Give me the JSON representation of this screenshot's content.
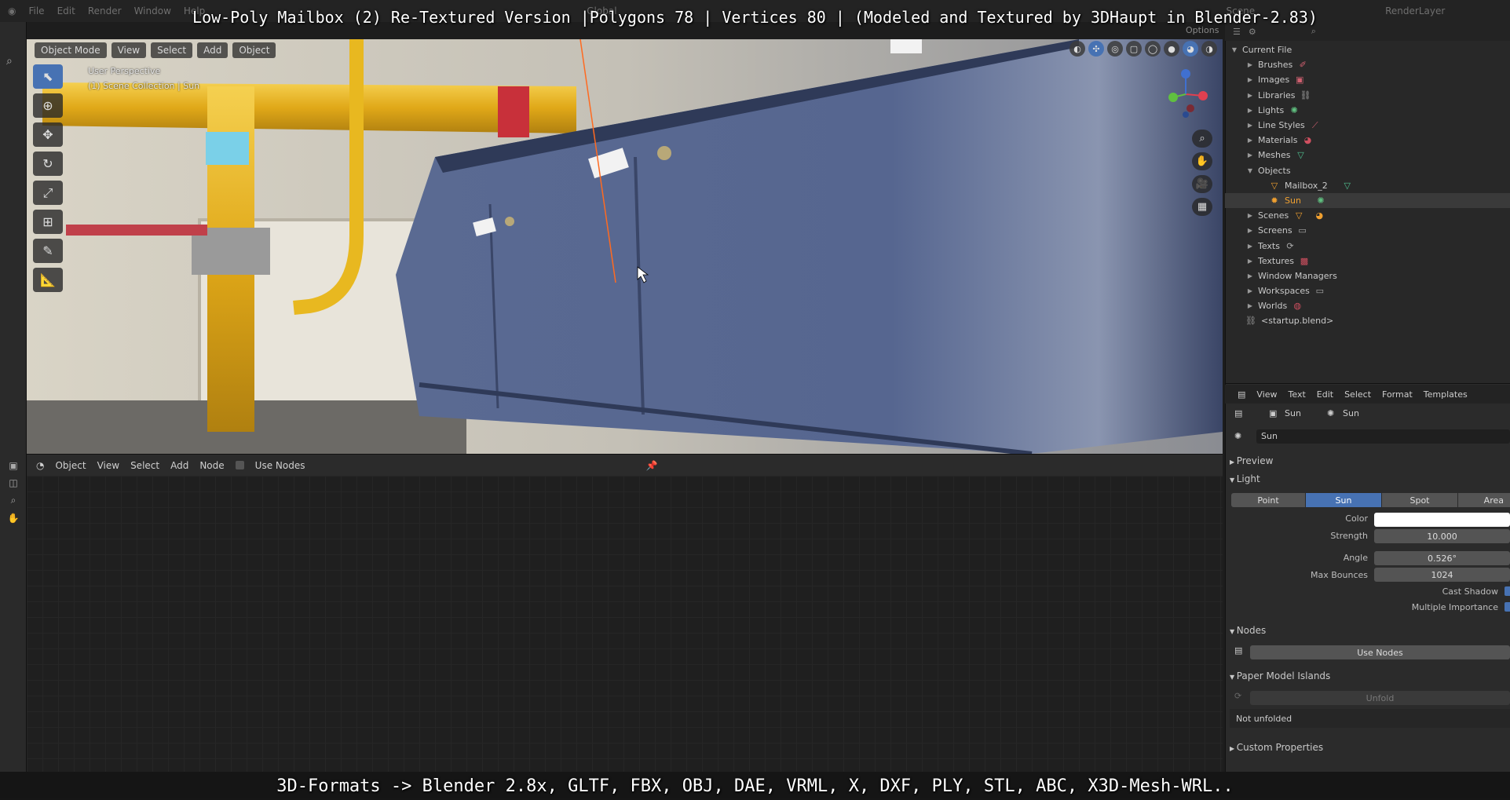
{
  "overlay": {
    "title": "Low-Poly Mailbox (2) Re-Textured Version |Polygons 78 | Vertices 80 | (Modeled and Textured by 3DHaupt in Blender-2.83)",
    "bottom": "3D-Formats -> Blender 2.8x, GLTF, FBX, OBJ, DAE, VRML, X, DXF, PLY, STL, ABC, X3D-Mesh-WRL.."
  },
  "topbar": {
    "menus": [
      "File",
      "Edit",
      "Render",
      "Window",
      "Help"
    ],
    "scene": "Scene",
    "render_layer": "RenderLayer",
    "orientation": "Global",
    "options": "Options"
  },
  "viewport": {
    "mode": "Object Mode",
    "menu": [
      "View",
      "Select",
      "Add",
      "Object"
    ],
    "perspective": "User Perspective",
    "collection": "(1) Scene Collection | Sun"
  },
  "node_editor": {
    "type": "Object",
    "menu": [
      "View",
      "Select",
      "Add",
      "Node"
    ],
    "use_nodes_label": "Use Nodes"
  },
  "outliner": {
    "root": "Current File",
    "items": [
      {
        "label": "Brushes",
        "icon": "brush-icon"
      },
      {
        "label": "Images",
        "icon": "image-icon"
      },
      {
        "label": "Libraries",
        "icon": "link-icon"
      },
      {
        "label": "Lights",
        "icon": "light-icon"
      },
      {
        "label": "Line Styles",
        "icon": "linestyle-icon"
      },
      {
        "label": "Materials",
        "icon": "material-icon"
      },
      {
        "label": "Meshes",
        "icon": "mesh-icon"
      },
      {
        "label": "Objects",
        "icon": ""
      },
      {
        "label": "Mailbox_2",
        "icon": "mesh-object-icon"
      },
      {
        "label": "Sun",
        "icon": "sun-light-icon"
      },
      {
        "label": "Scenes",
        "icon": "scene-icon"
      },
      {
        "label": "Screens",
        "icon": "screen-icon"
      },
      {
        "label": "Texts",
        "icon": "text-icon"
      },
      {
        "label": "Textures",
        "icon": "texture-icon"
      },
      {
        "label": "Window Managers",
        "icon": ""
      },
      {
        "label": "Workspaces",
        "icon": "workspace-icon"
      },
      {
        "label": "Worlds",
        "icon": "world-icon"
      },
      {
        "label": "<startup.blend>",
        "icon": "blend-file-icon"
      }
    ]
  },
  "text_editor_menu": [
    "View",
    "Text",
    "Edit",
    "Select",
    "Format",
    "Templates"
  ],
  "properties": {
    "breadcrumb_object": "Sun",
    "breadcrumb_data": "Sun",
    "datablock_name": "Sun",
    "preview_label": "Preview",
    "light_label": "Light",
    "light_types": [
      "Point",
      "Sun",
      "Spot",
      "Area"
    ],
    "active_light_type": "Sun",
    "color_label": "Color",
    "color_value": "#ffffff",
    "strength_label": "Strength",
    "strength_value": "10.000",
    "angle_label": "Angle",
    "angle_value": "0.526°",
    "max_bounces_label": "Max Bounces",
    "max_bounces_value": "1024",
    "cast_shadow_label": "Cast Shadow",
    "multiple_importance_label": "Multiple Importance",
    "nodes_label": "Nodes",
    "use_nodes_button": "Use Nodes",
    "paper_model_label": "Paper Model Islands",
    "unfold_button": "Unfold",
    "not_unfolded": "Not unfolded",
    "custom_properties_label": "Custom Properties"
  },
  "colors": {
    "accent": "#4772b3",
    "active_object": "#f0a030",
    "pipe_yellow": "#e8b820",
    "mailbox_blue": "#5a6a92"
  }
}
